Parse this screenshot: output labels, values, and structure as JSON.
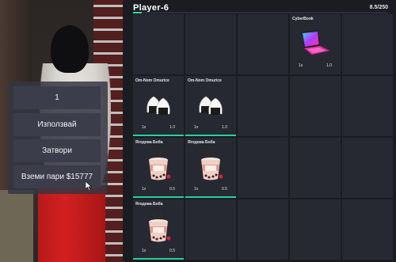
{
  "inventory": {
    "title": "Player-6",
    "weight_text": "8.5/250",
    "weight_fraction": 0.034,
    "accent_color": "#27cfa0",
    "slots": [
      {
        "name": "",
        "qty": "",
        "weight": "",
        "icon": ""
      },
      {
        "name": "",
        "qty": "",
        "weight": "",
        "icon": ""
      },
      {
        "name": "",
        "qty": "",
        "weight": "",
        "icon": ""
      },
      {
        "name": "CyberBook",
        "qty": "1x",
        "weight": "1.0",
        "icon": "laptop-icon",
        "durability": 0
      },
      {
        "name": "",
        "qty": "",
        "weight": "",
        "icon": ""
      },
      {
        "name": "Om-Nom Omurice",
        "qty": "1x",
        "weight": "1.0",
        "icon": "onigiri-icon",
        "durability": 1.0
      },
      {
        "name": "Om-Nom Omurice",
        "qty": "1x",
        "weight": "1.0",
        "icon": "onigiri-icon",
        "durability": 1.0
      },
      {
        "name": "",
        "qty": "",
        "weight": "",
        "icon": ""
      },
      {
        "name": "",
        "qty": "",
        "weight": "",
        "icon": ""
      },
      {
        "name": "",
        "qty": "",
        "weight": "",
        "icon": ""
      },
      {
        "name": "Ягодова Боба",
        "qty": "1x",
        "weight": "0.5",
        "icon": "boba-tea-icon",
        "durability": 1.0
      },
      {
        "name": "Ягодова Боба",
        "qty": "1x",
        "weight": "0.5",
        "icon": "boba-tea-icon",
        "durability": 1.0
      },
      {
        "name": "",
        "qty": "",
        "weight": "",
        "icon": ""
      },
      {
        "name": "",
        "qty": "",
        "weight": "",
        "icon": ""
      },
      {
        "name": "",
        "qty": "",
        "weight": "",
        "icon": ""
      },
      {
        "name": "Ягодова Боба",
        "qty": "1x",
        "weight": "0.5",
        "icon": "boba-tea-icon",
        "durability": 1.0
      },
      {
        "name": "",
        "qty": "",
        "weight": "",
        "icon": ""
      },
      {
        "name": "",
        "qty": "",
        "weight": "",
        "icon": ""
      },
      {
        "name": "",
        "qty": "",
        "weight": "",
        "icon": ""
      },
      {
        "name": "",
        "qty": "",
        "weight": "",
        "icon": ""
      }
    ]
  },
  "context_menu": {
    "amount": "1",
    "use_label": "Използвай",
    "close_label": "Затвори",
    "take_money_label": "Вземи пари $15777"
  }
}
